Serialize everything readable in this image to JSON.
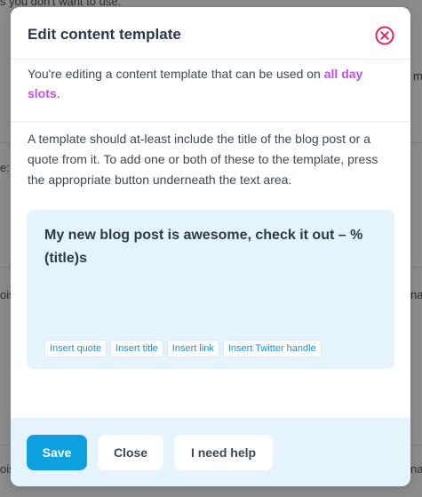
{
  "background": {
    "fragments": [
      "s you don't want to use.",
      "e:",
      "m",
      "ois",
      "na",
      "ois",
      "na"
    ]
  },
  "modal": {
    "title": "Edit content template",
    "close_icon": "close-circle-icon",
    "intro_prefix": "You're editing a content template that can be used on ",
    "intro_link": "all day slots",
    "intro_suffix": ".",
    "instructions": "A template should at-least include the title of the blog post or a quote from it. To add one or both of these to the template, press the appropriate button underneath the text area.",
    "template_text": "My new blog post is awesome, check it out – %(title)s",
    "insert_buttons": [
      "Insert quote",
      "Insert title",
      "Insert link",
      "Insert Twitter handle"
    ],
    "footer": {
      "save_label": "Save",
      "close_label": "Close",
      "help_label": "I need help"
    }
  },
  "colors": {
    "accent": "#c44de6",
    "primary": "#0ea0e0",
    "close_icon": "#e0245e",
    "panel_bg": "#e5f4fc"
  }
}
